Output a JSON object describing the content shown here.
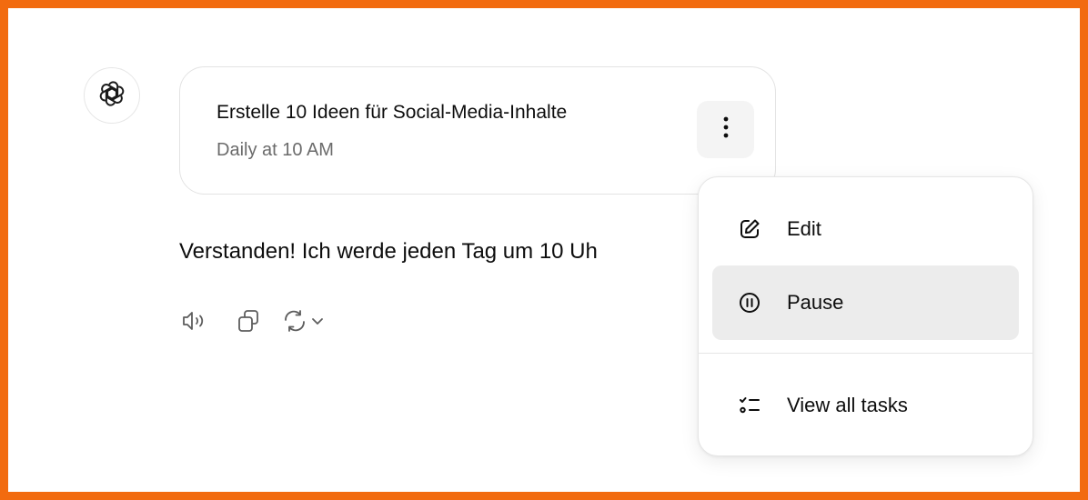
{
  "task": {
    "title": "Erstelle 10 Ideen für Social-Media-Inhalte",
    "schedule": "Daily at 10 AM"
  },
  "message": {
    "text": "Verstanden! Ich werde jeden Tag um 10 Uh"
  },
  "menu": {
    "items": [
      {
        "label": "Edit",
        "icon": "edit-icon"
      },
      {
        "label": "Pause",
        "icon": "pause-icon"
      },
      {
        "label": "View all tasks",
        "icon": "tasks-list-icon"
      }
    ]
  },
  "colors": {
    "frame": "#f26b0f",
    "hover": "#ececec"
  }
}
